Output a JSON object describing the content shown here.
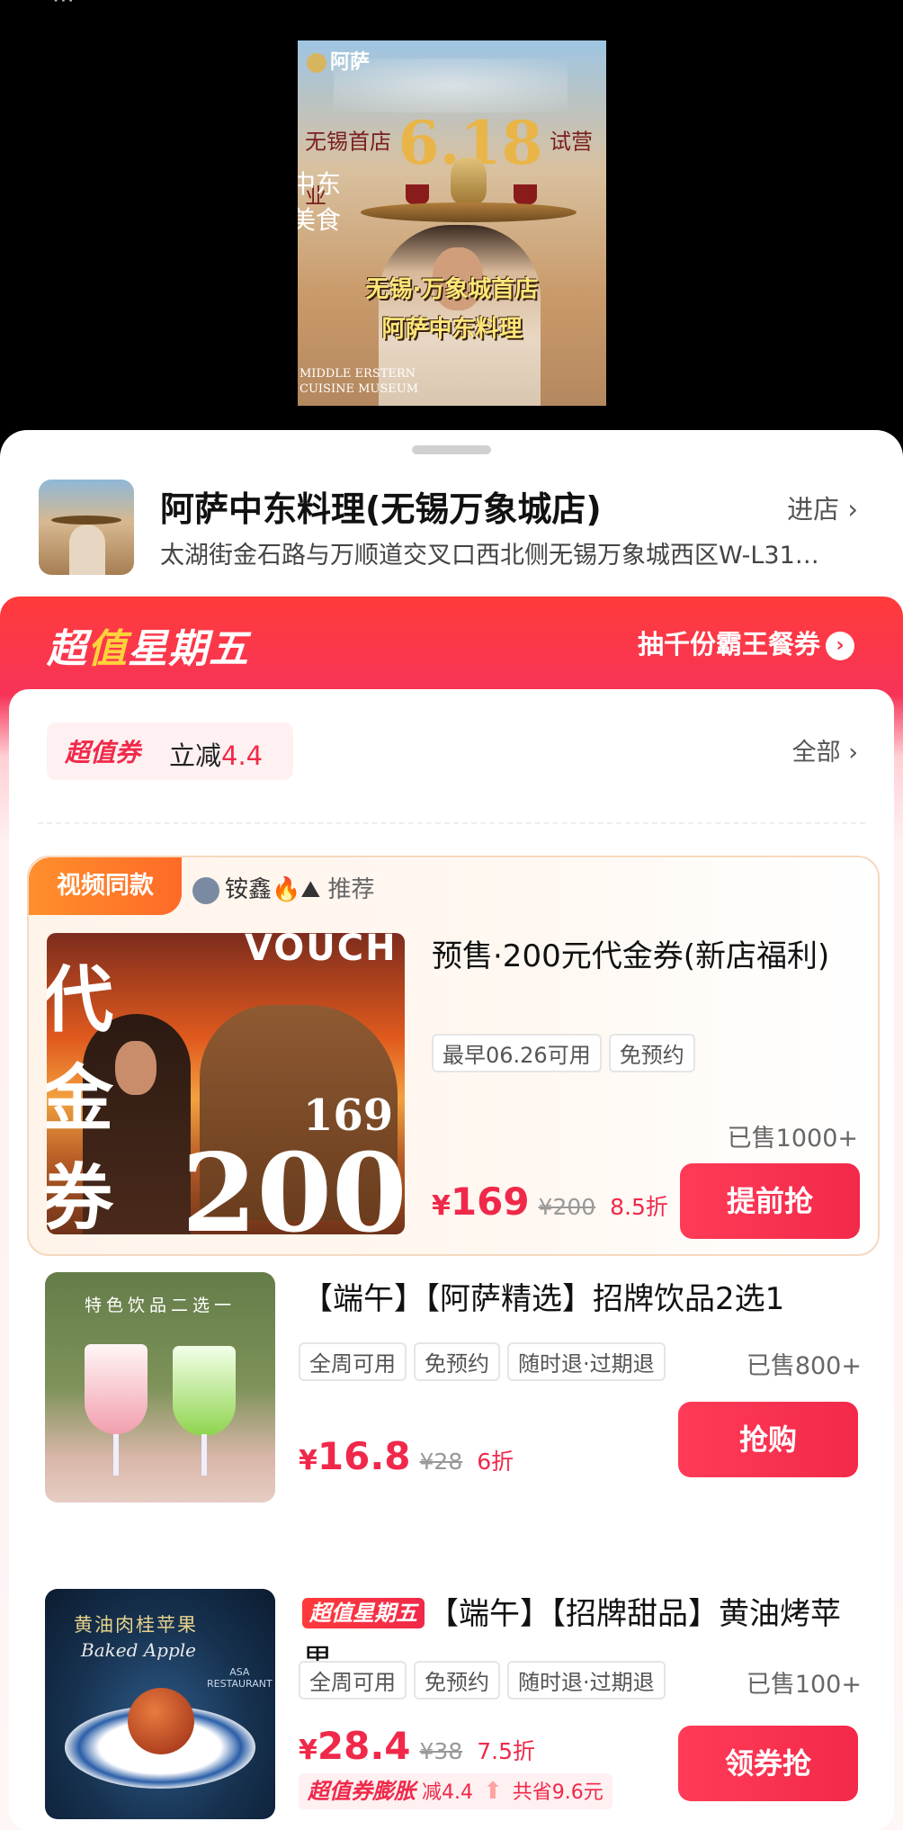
{
  "poster": {
    "brand": "阿萨",
    "opening_prefix": "无锡首店",
    "opening_date": "6.18",
    "opening_suffix": "试营业",
    "side_text": "中东\n美食",
    "caption_1": "无锡·万象城首店",
    "caption_2": "阿萨中东料理",
    "museum_1": "MIDDLE ERSTERN",
    "museum_2": "CUISINE MUSEUM"
  },
  "store": {
    "name": "阿萨中东料理(无锡万象城店)",
    "address": "太湖街金石路与万顺道交叉口西北侧无锡万象城西区W-L31…",
    "enter_label": "进店 ›"
  },
  "promo": {
    "title_left": "超",
    "title_bolt": "值",
    "title_right": "星期五",
    "lottery_label": "抽千份霸王餐券",
    "lottery_icon": "›",
    "coupon_tag": "超值券",
    "coupon_text": "立减",
    "coupon_amount": "4.4",
    "all_label": "全部 ›"
  },
  "featured": {
    "video_tag": "视频同款",
    "recommender": "铵鑫",
    "recommend_label": "推荐",
    "title": "预售·200元代金券(新店福利)",
    "tags": [
      "最早06.26可用",
      "免预约"
    ],
    "sold": "已售1000+",
    "currency": "¥",
    "price": "169",
    "original": "¥200",
    "discount": "8.5折",
    "button": "提前抢",
    "image_big": "200",
    "image_small": "169",
    "image_vouch": "VOUCH",
    "image_vert": "代金券"
  },
  "items": [
    {
      "title": "【端午】【阿萨精选】招牌饮品2选1",
      "tags": [
        "全周可用",
        "免预约",
        "随时退·过期退"
      ],
      "sold": "已售800+",
      "currency": "¥",
      "price": "16.8",
      "original": "¥28",
      "discount": "6折",
      "button": "抢购",
      "image_caption": "特色饮品二选一"
    },
    {
      "badge": "超值星期五",
      "title": "【端午】【招牌甜品】黄油烤苹果",
      "tags": [
        "全周可用",
        "免预约",
        "随时退·过期退"
      ],
      "sold": "已售100+",
      "currency": "¥",
      "price": "28.4",
      "original": "¥38",
      "discount": "7.5折",
      "button": "领券抢",
      "image_caption": "黄油肉桂苹果",
      "image_caption_en": "Baked Apple",
      "image_asa": "ASA\nRESTAURANT",
      "coupon_expand_label": "超值券膨胀",
      "coupon_expand_reduce": "减4.4",
      "coupon_expand_save": "共省9.6元"
    }
  ]
}
